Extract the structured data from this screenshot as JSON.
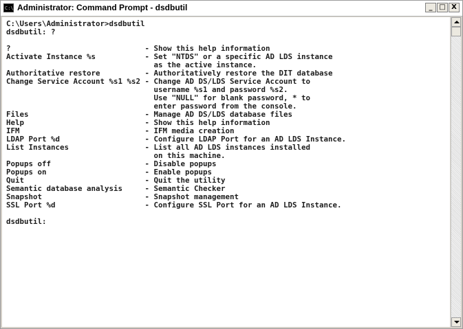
{
  "window": {
    "title": "Administrator: Command Prompt - dsdbutil",
    "icon_text": "C:\\",
    "buttons": {
      "minimize": "_",
      "maximize": "□",
      "close": "X"
    }
  },
  "console": {
    "lines": [
      "C:\\Users\\Administrator>dsdbutil",
      "dsdbutil: ?",
      "",
      "?                              - Show this help information",
      "Activate Instance %s           - Set \"NTDS\" or a specific AD LDS instance",
      "                                 as the active instance.",
      "Authoritative restore          - Authoritatively restore the DIT database",
      "Change Service Account %s1 %s2 - Change AD DS/LDS Service Account to",
      "                                 username %s1 and password %s2.",
      "                                 Use \"NULL\" for blank password, * to",
      "                                 enter password from the console.",
      "Files                          - Manage AD DS/LDS database files",
      "Help                           - Show this help information",
      "IFM                            - IFM media creation",
      "LDAP Port %d                   - Configure LDAP Port for an AD LDS Instance.",
      "List Instances                 - List all AD LDS instances installed",
      "                                 on this machine.",
      "Popups off                     - Disable popups",
      "Popups on                      - Enable popups",
      "Quit                           - Quit the utility",
      "Semantic database analysis     - Semantic Checker",
      "Snapshot                       - Snapshot management",
      "SSL Port %d                    - Configure SSL Port for an AD LDS Instance.",
      "",
      "dsdbutil:"
    ]
  }
}
